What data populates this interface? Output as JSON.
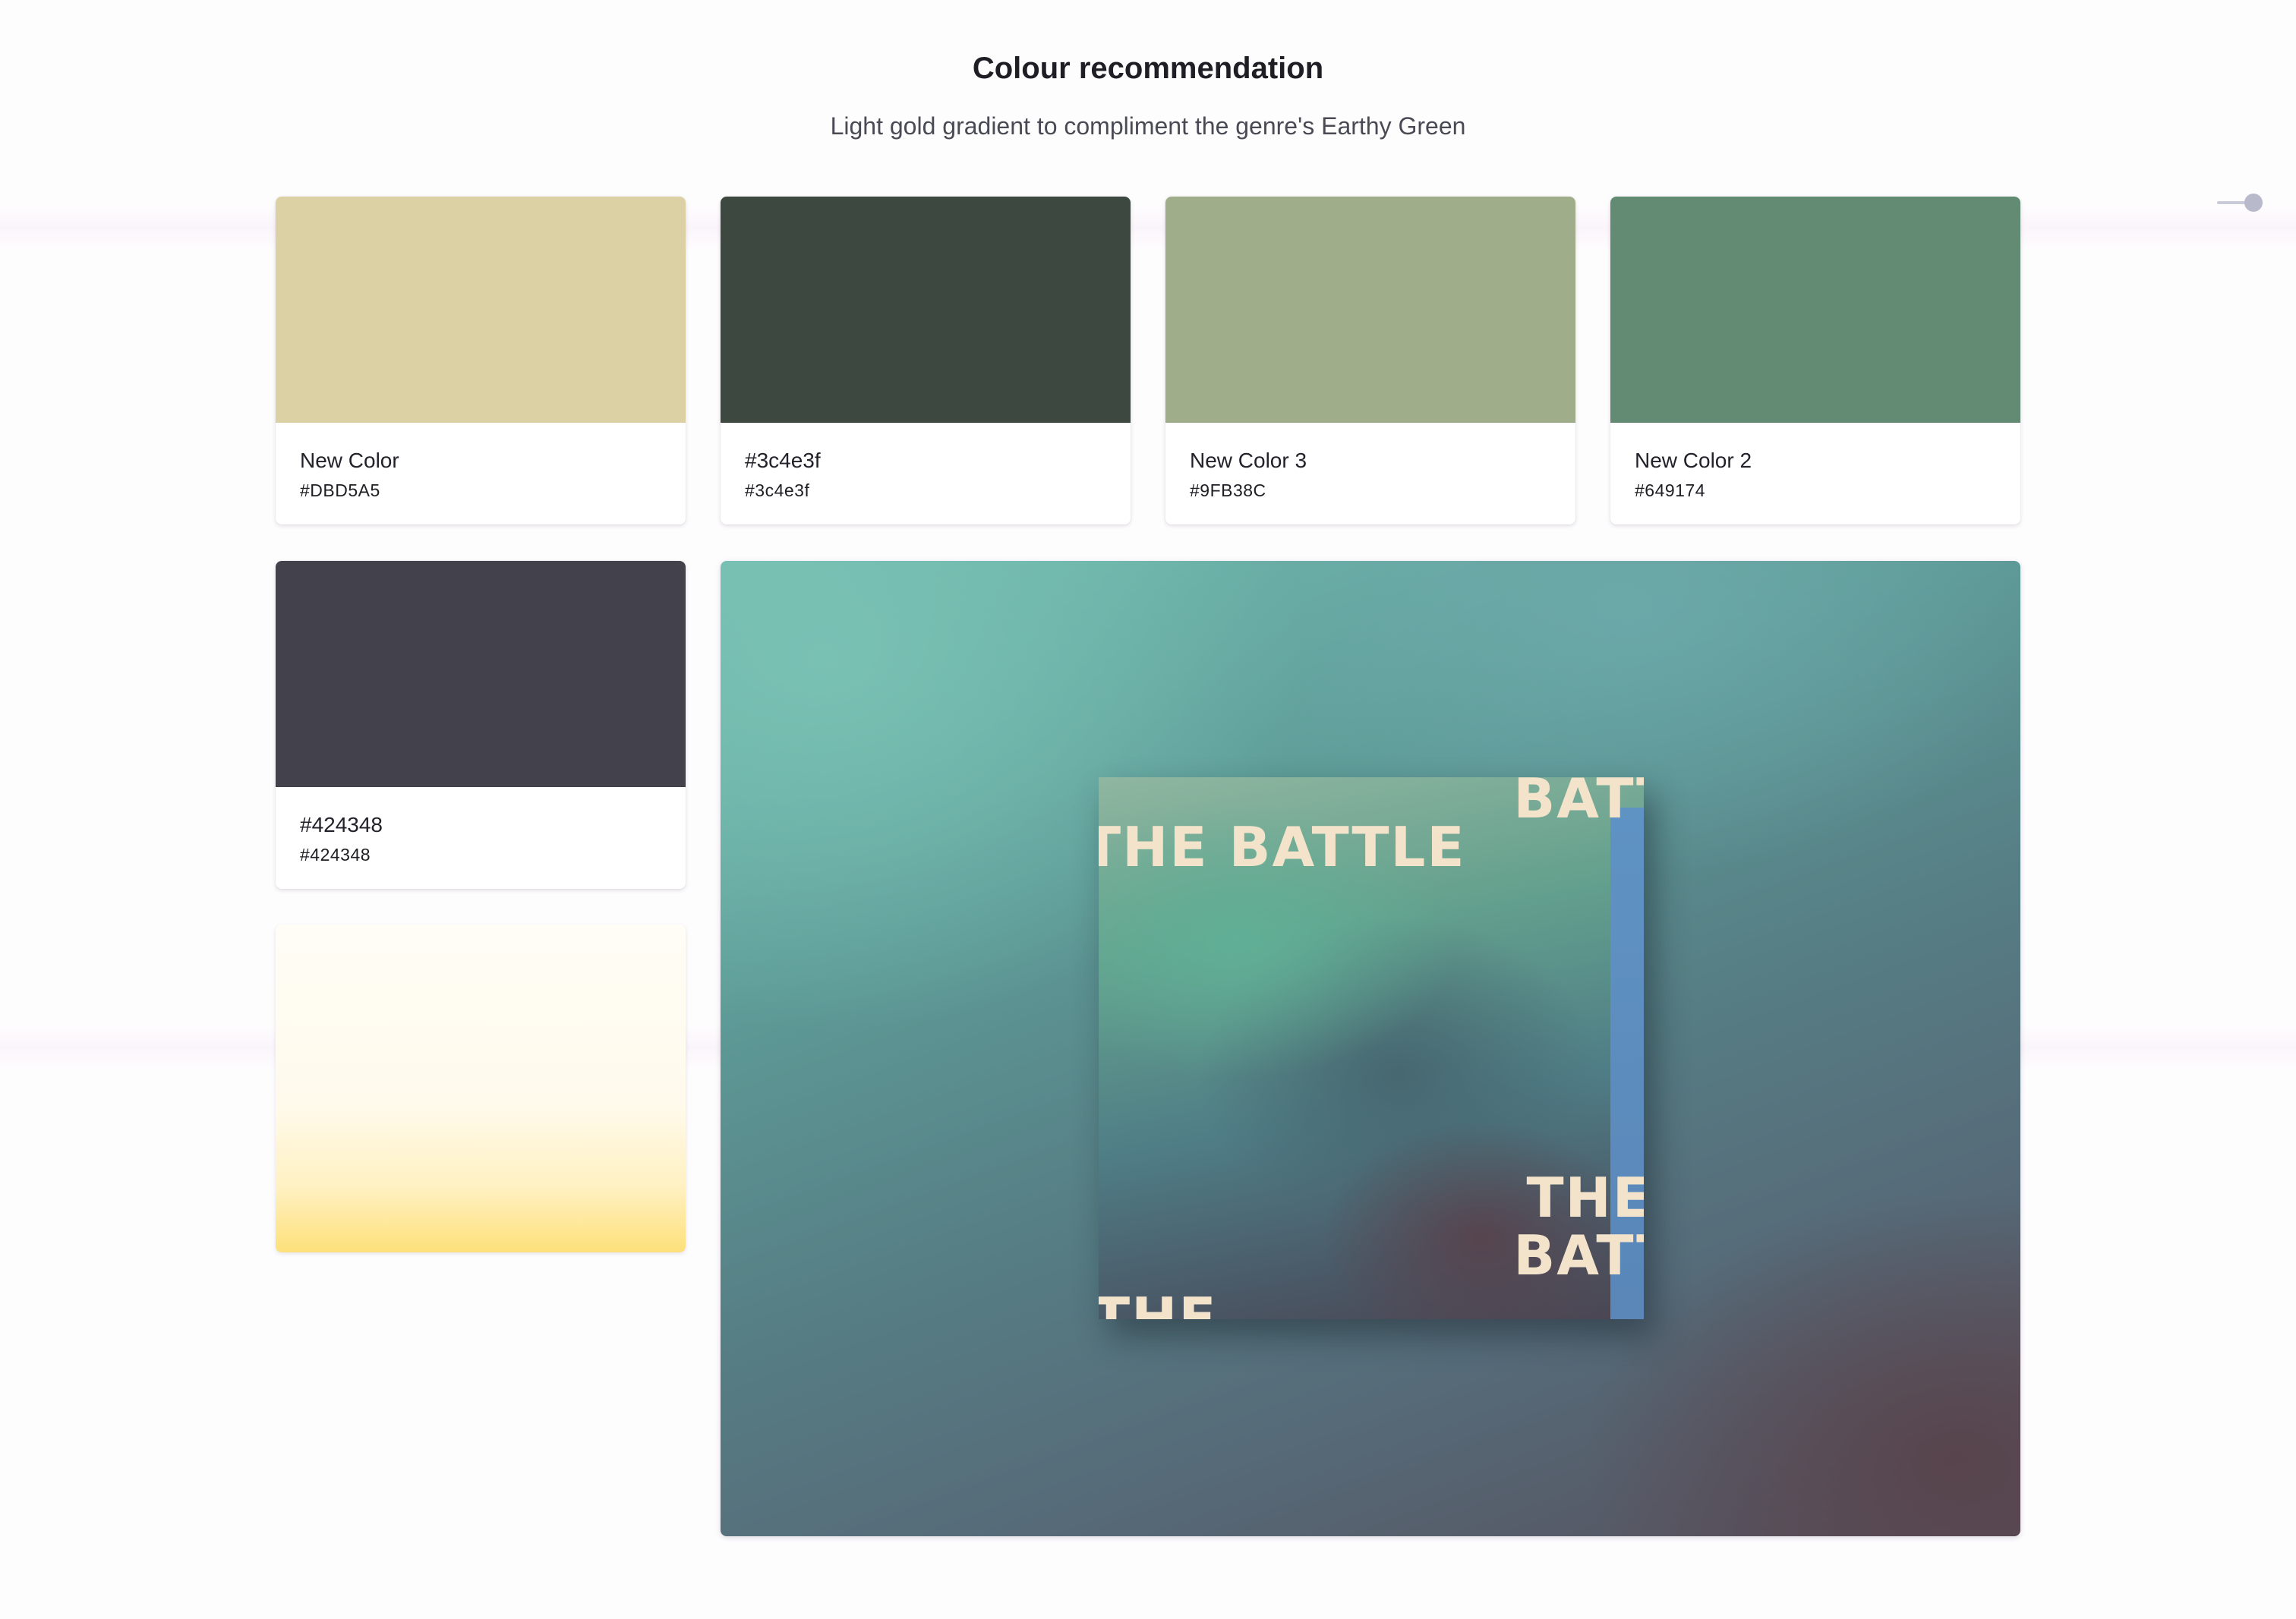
{
  "header": {
    "title": "Colour recommendation",
    "subtitle": "Light gold gradient to compliment the genre's Earthy Green"
  },
  "colors": [
    {
      "name": "New Color",
      "hex": "#DBD5A5",
      "swatch": "#dcd1a4"
    },
    {
      "name": "#3c4e3f",
      "hex": "#3c4e3f",
      "swatch": "#3c4840"
    },
    {
      "name": "New Color 3",
      "hex": "#9FB38C",
      "swatch": "#9fad8b"
    },
    {
      "name": "New Color 2",
      "hex": "#649174",
      "swatch": "#638b74"
    },
    {
      "name": "#424348",
      "hex": "#424348",
      "swatch": "#43424c"
    }
  ],
  "gradient": {
    "from": "#fffdf6",
    "to": "#fde07a"
  },
  "album": {
    "lines": [
      "BATTI",
      "THE BATTLE",
      "THE",
      "BATTI",
      "THE"
    ]
  },
  "icons": {
    "slider": "slider-toggle-icon"
  }
}
